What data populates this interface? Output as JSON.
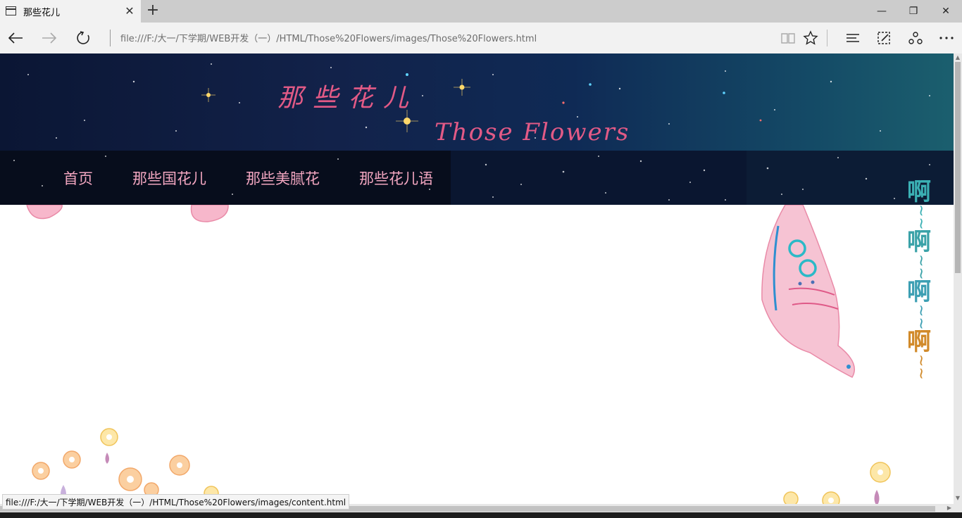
{
  "browser": {
    "tab_title": "那些花儿",
    "tab_close": "✕",
    "new_tab": "+",
    "window_minimize": "—",
    "window_restore": "❐",
    "window_close": "✕",
    "url": "file:///F:/大一/下学期/WEB开发（一）/HTML/Those%20Flowers/images/Those%20Flowers.html",
    "status_url": "file:///F:/大一/下学期/WEB开发（一）/HTML/Those%20Flowers/images/content.html",
    "icons": [
      "page-icon",
      "back-arrow-icon",
      "forward-arrow-icon",
      "refresh-icon",
      "reading-view-icon",
      "favorite-star-icon",
      "hub-icon",
      "web-note-icon",
      "share-icon",
      "more-icon"
    ]
  },
  "site": {
    "title_cn": "那些花儿",
    "title_en": "Those Flowers",
    "nav": [
      {
        "label": "首页"
      },
      {
        "label": "那些国花儿"
      },
      {
        "label": "那些美腻花"
      },
      {
        "label": "那些花儿语"
      }
    ],
    "side_text": [
      {
        "char": "啊",
        "tilde": "~~",
        "color": "#3bb0b4"
      },
      {
        "char": "啊",
        "tilde": "~~",
        "color": "#3aa2a8"
      },
      {
        "char": "啊",
        "tilde": "~~",
        "color": "#3c9fb3"
      },
      {
        "char": "啊",
        "tilde": "~~",
        "color": "#d18a2a"
      }
    ]
  },
  "colors": {
    "accent_pink": "#e25a86",
    "nav_text": "#f2a6c0",
    "banner_dark": "#0b1634"
  }
}
